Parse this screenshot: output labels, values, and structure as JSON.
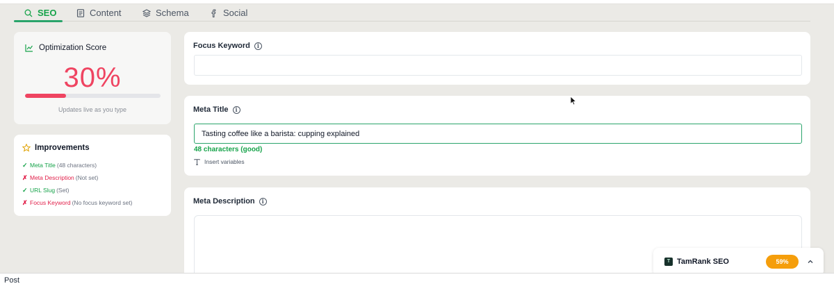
{
  "tabs": [
    {
      "label": "SEO",
      "icon": "search-icon",
      "active": true
    },
    {
      "label": "Content",
      "icon": "document-icon",
      "active": false
    },
    {
      "label": "Schema",
      "icon": "layers-icon",
      "active": false
    },
    {
      "label": "Social",
      "icon": "facebook-icon",
      "active": false
    }
  ],
  "score": {
    "title": "Optimization Score",
    "value": "30%",
    "progress": 0.3,
    "note": "Updates live as you type",
    "color": "#ef4461"
  },
  "improvements": {
    "title": "Improvements",
    "items": [
      {
        "status": "ok",
        "mark": "✓",
        "label": "Meta Title",
        "detail": "(48 characters)"
      },
      {
        "status": "bad",
        "mark": "✗",
        "label": "Meta Description",
        "detail": "(Not set)"
      },
      {
        "status": "ok",
        "mark": "✓",
        "label": "URL Slug",
        "detail": "(Set)"
      },
      {
        "status": "bad",
        "mark": "✗",
        "label": "Focus Keyword",
        "detail": "(No focus keyword set)"
      }
    ]
  },
  "fields": {
    "focus_keyword": {
      "label": "Focus Keyword",
      "value": ""
    },
    "meta_title": {
      "label": "Meta Title",
      "value": "Tasting coffee like a barista: cupping explained",
      "char_count": "48 characters (good)",
      "insert_label": "Insert variables"
    },
    "meta_description": {
      "label": "Meta Description",
      "value": ""
    }
  },
  "widget": {
    "name": "TamRank SEO",
    "logo": "T",
    "score": "59%"
  },
  "footer": {
    "text": "Post"
  },
  "colors": {
    "accent": "#2aa46b",
    "error": "#e11d48",
    "warning": "#f59e0b"
  }
}
